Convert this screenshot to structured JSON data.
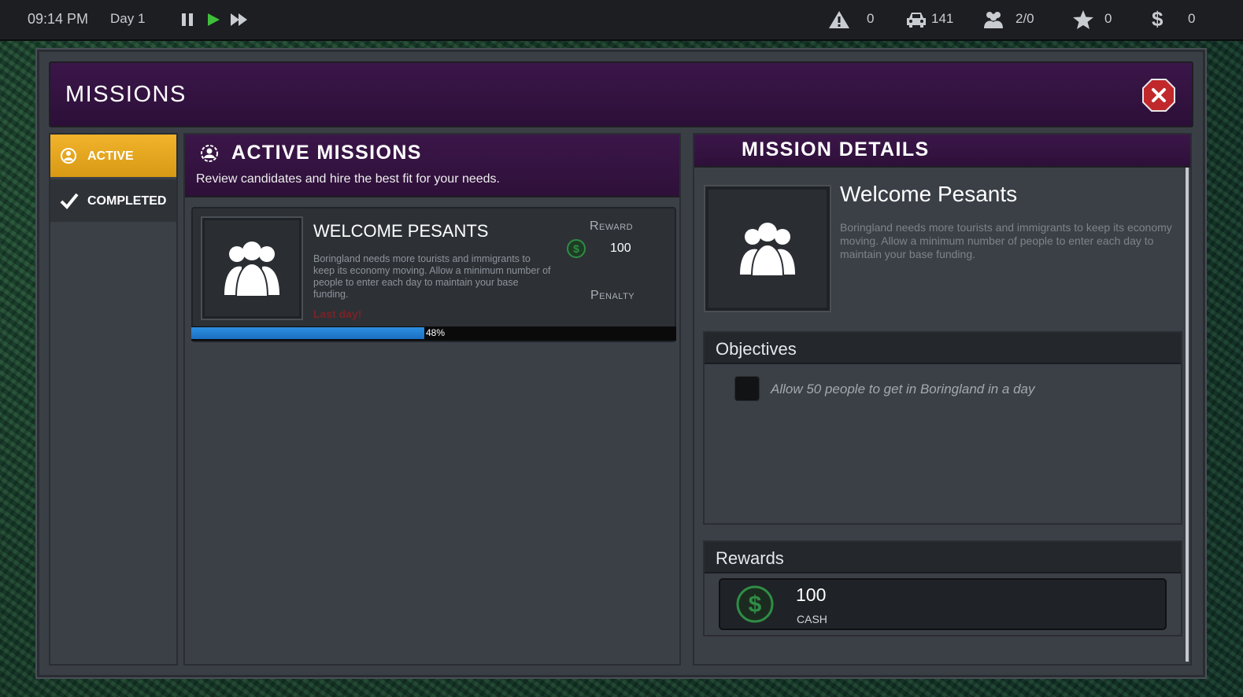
{
  "topbar": {
    "time": "09:14 PM",
    "day": "Day 1",
    "alerts": "0",
    "vehicles": "141",
    "people": "2/0",
    "stars": "0",
    "money": "0"
  },
  "modal": {
    "title": "MISSIONS"
  },
  "sidebar": {
    "tabs": [
      {
        "label": "ACTIVE"
      },
      {
        "label": "COMPLETED"
      }
    ]
  },
  "active_missions": {
    "title": "ACTIVE MISSIONS",
    "subtitle": "Review candidates and hire the best fit for your needs.",
    "missions": [
      {
        "name": "WELCOME PESANTS",
        "description": "Boringland needs more tourists and immigrants to keep its economy moving. Allow a minimum number of people to enter each day to maintain your base funding.",
        "deadline": "Last day!",
        "reward_label": "Reward",
        "reward_value": "100",
        "penalty_label": "Penalty",
        "progress": 0.48,
        "progress_text": "48%"
      }
    ]
  },
  "mission_details": {
    "title": "MISSION DETAILS",
    "name": "Welcome Pesants",
    "description": "Boringland needs more tourists and immigrants to keep its economy moving. Allow a minimum number of people to enter each day to maintain your base funding.",
    "objectives_title": "Objectives",
    "objectives": [
      {
        "text": "Allow 50 people to get in Boringland in a day",
        "done": false
      }
    ],
    "rewards_title": "Rewards",
    "rewards": [
      {
        "value": "100",
        "label": "CASH"
      }
    ]
  },
  "colors": {
    "accent_active_tab": "#f1b32b",
    "header_purple": "#3b1649",
    "progress_blue": "#2d8fe0",
    "close_red": "#c0282c",
    "cash_green": "#2f8c45",
    "deadline_red": "#7a2226"
  },
  "icons": [
    "warning-icon",
    "car-icon",
    "people-icon",
    "star-icon",
    "dollar-icon",
    "pause-icon",
    "play-icon",
    "fast-forward-icon",
    "close-icon",
    "mission-icon",
    "check-icon",
    "group-icon",
    "coin-icon"
  ]
}
